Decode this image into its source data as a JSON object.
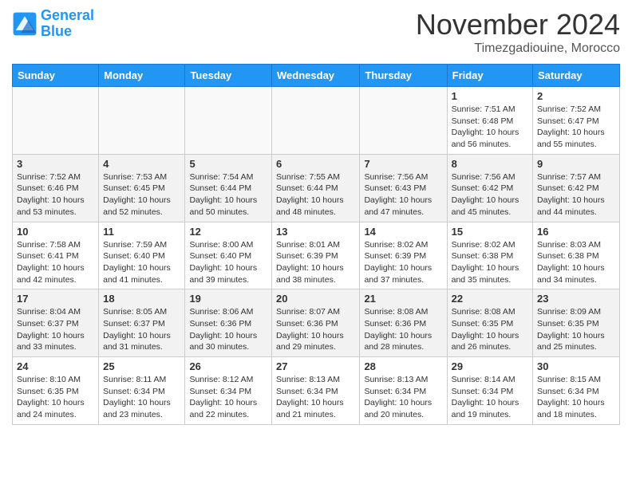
{
  "header": {
    "logo_line1": "General",
    "logo_line2": "Blue",
    "month": "November 2024",
    "location": "Timezgadiouine, Morocco"
  },
  "weekdays": [
    "Sunday",
    "Monday",
    "Tuesday",
    "Wednesday",
    "Thursday",
    "Friday",
    "Saturday"
  ],
  "weeks": [
    [
      {
        "day": "",
        "info": ""
      },
      {
        "day": "",
        "info": ""
      },
      {
        "day": "",
        "info": ""
      },
      {
        "day": "",
        "info": ""
      },
      {
        "day": "",
        "info": ""
      },
      {
        "day": "1",
        "info": "Sunrise: 7:51 AM\nSunset: 6:48 PM\nDaylight: 10 hours\nand 56 minutes."
      },
      {
        "day": "2",
        "info": "Sunrise: 7:52 AM\nSunset: 6:47 PM\nDaylight: 10 hours\nand 55 minutes."
      }
    ],
    [
      {
        "day": "3",
        "info": "Sunrise: 7:52 AM\nSunset: 6:46 PM\nDaylight: 10 hours\nand 53 minutes."
      },
      {
        "day": "4",
        "info": "Sunrise: 7:53 AM\nSunset: 6:45 PM\nDaylight: 10 hours\nand 52 minutes."
      },
      {
        "day": "5",
        "info": "Sunrise: 7:54 AM\nSunset: 6:44 PM\nDaylight: 10 hours\nand 50 minutes."
      },
      {
        "day": "6",
        "info": "Sunrise: 7:55 AM\nSunset: 6:44 PM\nDaylight: 10 hours\nand 48 minutes."
      },
      {
        "day": "7",
        "info": "Sunrise: 7:56 AM\nSunset: 6:43 PM\nDaylight: 10 hours\nand 47 minutes."
      },
      {
        "day": "8",
        "info": "Sunrise: 7:56 AM\nSunset: 6:42 PM\nDaylight: 10 hours\nand 45 minutes."
      },
      {
        "day": "9",
        "info": "Sunrise: 7:57 AM\nSunset: 6:42 PM\nDaylight: 10 hours\nand 44 minutes."
      }
    ],
    [
      {
        "day": "10",
        "info": "Sunrise: 7:58 AM\nSunset: 6:41 PM\nDaylight: 10 hours\nand 42 minutes."
      },
      {
        "day": "11",
        "info": "Sunrise: 7:59 AM\nSunset: 6:40 PM\nDaylight: 10 hours\nand 41 minutes."
      },
      {
        "day": "12",
        "info": "Sunrise: 8:00 AM\nSunset: 6:40 PM\nDaylight: 10 hours\nand 39 minutes."
      },
      {
        "day": "13",
        "info": "Sunrise: 8:01 AM\nSunset: 6:39 PM\nDaylight: 10 hours\nand 38 minutes."
      },
      {
        "day": "14",
        "info": "Sunrise: 8:02 AM\nSunset: 6:39 PM\nDaylight: 10 hours\nand 37 minutes."
      },
      {
        "day": "15",
        "info": "Sunrise: 8:02 AM\nSunset: 6:38 PM\nDaylight: 10 hours\nand 35 minutes."
      },
      {
        "day": "16",
        "info": "Sunrise: 8:03 AM\nSunset: 6:38 PM\nDaylight: 10 hours\nand 34 minutes."
      }
    ],
    [
      {
        "day": "17",
        "info": "Sunrise: 8:04 AM\nSunset: 6:37 PM\nDaylight: 10 hours\nand 33 minutes."
      },
      {
        "day": "18",
        "info": "Sunrise: 8:05 AM\nSunset: 6:37 PM\nDaylight: 10 hours\nand 31 minutes."
      },
      {
        "day": "19",
        "info": "Sunrise: 8:06 AM\nSunset: 6:36 PM\nDaylight: 10 hours\nand 30 minutes."
      },
      {
        "day": "20",
        "info": "Sunrise: 8:07 AM\nSunset: 6:36 PM\nDaylight: 10 hours\nand 29 minutes."
      },
      {
        "day": "21",
        "info": "Sunrise: 8:08 AM\nSunset: 6:36 PM\nDaylight: 10 hours\nand 28 minutes."
      },
      {
        "day": "22",
        "info": "Sunrise: 8:08 AM\nSunset: 6:35 PM\nDaylight: 10 hours\nand 26 minutes."
      },
      {
        "day": "23",
        "info": "Sunrise: 8:09 AM\nSunset: 6:35 PM\nDaylight: 10 hours\nand 25 minutes."
      }
    ],
    [
      {
        "day": "24",
        "info": "Sunrise: 8:10 AM\nSunset: 6:35 PM\nDaylight: 10 hours\nand 24 minutes."
      },
      {
        "day": "25",
        "info": "Sunrise: 8:11 AM\nSunset: 6:34 PM\nDaylight: 10 hours\nand 23 minutes."
      },
      {
        "day": "26",
        "info": "Sunrise: 8:12 AM\nSunset: 6:34 PM\nDaylight: 10 hours\nand 22 minutes."
      },
      {
        "day": "27",
        "info": "Sunrise: 8:13 AM\nSunset: 6:34 PM\nDaylight: 10 hours\nand 21 minutes."
      },
      {
        "day": "28",
        "info": "Sunrise: 8:13 AM\nSunset: 6:34 PM\nDaylight: 10 hours\nand 20 minutes."
      },
      {
        "day": "29",
        "info": "Sunrise: 8:14 AM\nSunset: 6:34 PM\nDaylight: 10 hours\nand 19 minutes."
      },
      {
        "day": "30",
        "info": "Sunrise: 8:15 AM\nSunset: 6:34 PM\nDaylight: 10 hours\nand 18 minutes."
      }
    ]
  ]
}
